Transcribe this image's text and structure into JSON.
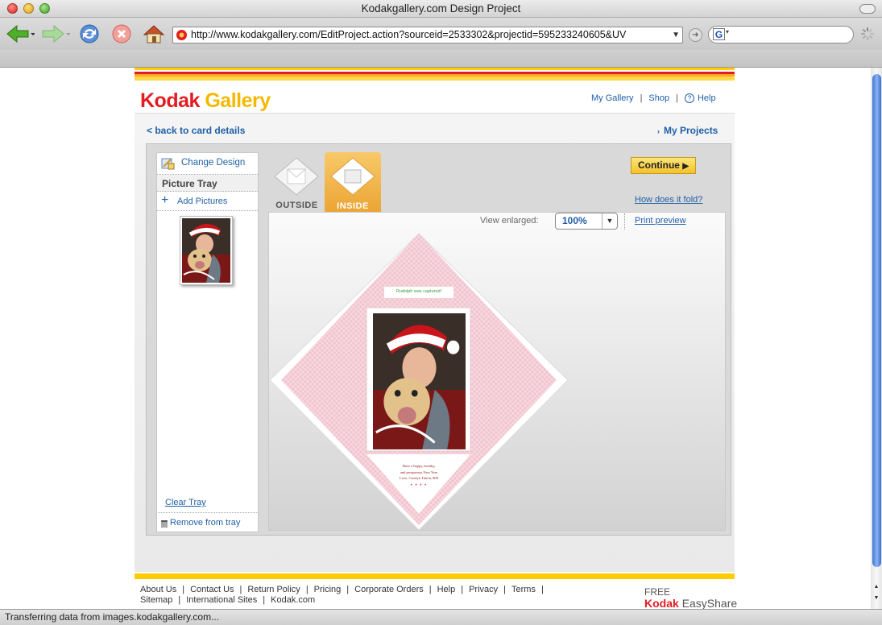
{
  "window": {
    "title": "Kodakgallery.com Design Project"
  },
  "browser": {
    "url": "http://www.kodakgallery.com/EditProject.action?sourceid=2533302&projectid=595233240605&UV",
    "search_placeholder": "",
    "search_engine_glyph": "G",
    "status": "Transferring data from images.kodakgallery.com..."
  },
  "header": {
    "logo_part1": "Kodak",
    "logo_part2": "Gallery",
    "nav": {
      "my_gallery": "My Gallery",
      "sep": "|",
      "shop": "Shop",
      "help": "Help"
    }
  },
  "page": {
    "back_link": "< back to card details",
    "my_projects": "My Projects"
  },
  "tray": {
    "change_design": "Change Design",
    "title": "Picture Tray",
    "add_pictures": "Add Pictures",
    "clear_tray": "Clear Tray",
    "remove_from_tray": "Remove from tray"
  },
  "tabs": {
    "outside": "OUTSIDE",
    "inside": "INSIDE"
  },
  "actions": {
    "continue": "Continue",
    "how_fold": "How does it fold?",
    "view_enlarged": "View enlarged:",
    "zoom": "100%",
    "print_preview": "Print preview"
  },
  "card": {
    "banner": "Rudolph was captured!",
    "msg1": "Have a happy, healthy,",
    "msg2": "and prosperous New Year",
    "msg3": "Love, Carolyn Timon, 800"
  },
  "footer": {
    "row1": [
      "About Us",
      "Contact Us",
      "Return Policy",
      "Pricing",
      "Corporate Orders",
      "Help",
      "Privacy",
      "Terms"
    ],
    "row2": [
      "Sitemap",
      "International Sites",
      "Kodak.com"
    ],
    "free": "FREE",
    "brand": "Kodak",
    "product": "EasyShare"
  },
  "colors": {
    "accent_link": "#1f5fa8",
    "kodak_red": "#e31b23",
    "kodak_yellow": "#ffcc00",
    "card_pink": "#f2c4cf"
  }
}
